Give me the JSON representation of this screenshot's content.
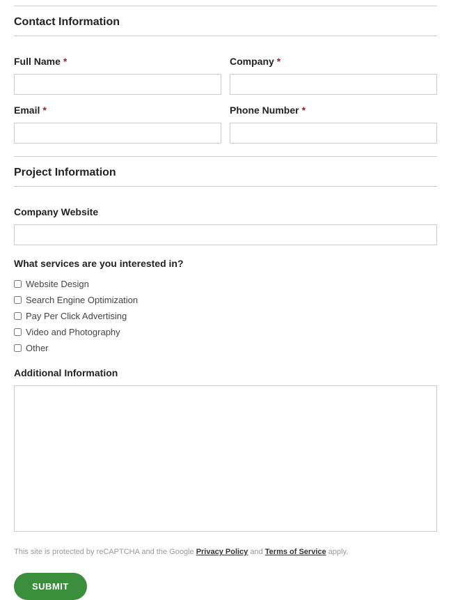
{
  "sections": {
    "contact": {
      "heading": "Contact Information",
      "fields": {
        "full_name": {
          "label": "Full Name",
          "required": "*"
        },
        "company": {
          "label": "Company",
          "required": "*"
        },
        "email": {
          "label": "Email",
          "required": "*"
        },
        "phone": {
          "label": "Phone Number",
          "required": "*"
        }
      }
    },
    "project": {
      "heading": "Project Information",
      "company_website": {
        "label": "Company Website"
      },
      "services": {
        "label": "What services are you interested in?",
        "options": [
          "Website Design",
          "Search Engine Optimization",
          "Pay Per Click Advertising",
          "Video and Photography",
          "Other"
        ]
      },
      "additional_info": {
        "label": "Additional Information"
      }
    }
  },
  "recaptcha": {
    "prefix": "This site is protected by reCAPTCHA and the Google ",
    "privacy": "Privacy Policy",
    "and": " and ",
    "terms": "Terms of Service",
    "suffix": " apply."
  },
  "submit": {
    "label": "SUBMIT"
  }
}
